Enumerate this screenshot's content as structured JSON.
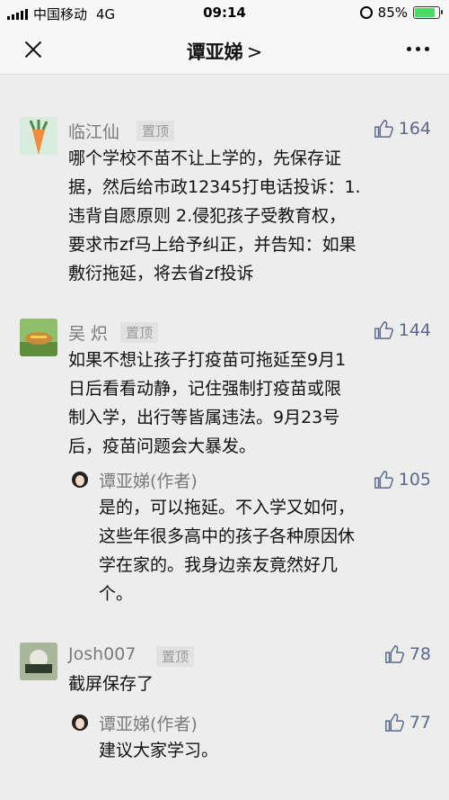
{
  "status": {
    "carrier": "中国移动",
    "network": "4G",
    "time": "09:14",
    "battery": "85%",
    "battery_level": 0.85
  },
  "nav": {
    "title": "谭亚娣",
    "chevron": ">"
  },
  "comments": [
    {
      "name": "临江仙",
      "badge": "置顶",
      "likes": "164",
      "lines": [
        "哪个学校不苗不让上学的，先保存证",
        "据，然后给市政12345打电话投诉：1.",
        "违背自愿原则 2.侵犯孩子受教育权，",
        "要求市zf马上给予纠正，并告知：如果",
        "敷衍拖延，将去省zf投诉"
      ],
      "reply": null
    },
    {
      "name": "吴 炽",
      "badge": "置顶",
      "likes": "144",
      "lines": [
        "如果不想让孩子打疫苗可拖延至9月1",
        "日后看看动静，记住强制打疫苗或限",
        "制入学，出行等皆属违法。9月23号",
        "后，疫苗问题会大暴发。"
      ],
      "reply": {
        "name": "谭亚娣(作者)",
        "likes": "105",
        "lines": [
          "是的，可以拖延。不入学又如何，",
          "这些年很多高中的孩子各种原因休",
          "学在家的。我身边亲友竟然好几",
          "个。"
        ]
      }
    },
    {
      "name": "Josh007",
      "badge": "置顶",
      "likes": "78",
      "lines": [
        "截屏保存了"
      ],
      "reply": {
        "name": "谭亚娣(作者)",
        "likes": "77",
        "lines": [
          "建议大家学习。"
        ]
      }
    }
  ]
}
